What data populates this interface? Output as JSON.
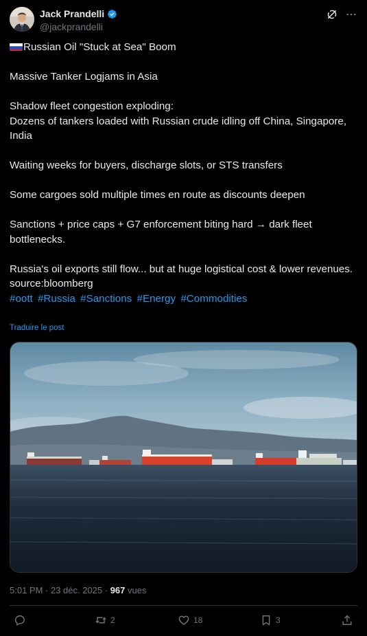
{
  "author": {
    "display_name": "Jack Prandelli",
    "handle": "@jackprandelli",
    "verified": true
  },
  "icons": {
    "verified": "verified-badge-icon",
    "grok": "grok-icon",
    "more": "more-dots-icon",
    "reply": "reply-icon",
    "repost": "repost-icon",
    "like": "heart-icon",
    "bookmark": "bookmark-icon",
    "share": "share-icon"
  },
  "tweet": {
    "line1": "Russian Oil \"Stuck at Sea\" Boom",
    "line2": "Massive Tanker Logjams in Asia",
    "line3a": "Shadow fleet congestion exploding:",
    "line3b": "Dozens of tankers loaded with Russian crude idling off China, Singapore, India",
    "line4": "Waiting weeks for buyers, discharge slots, or STS transfers",
    "line5": "Some cargoes sold multiple times en route as discounts deepen",
    "line6": "Sanctions + price caps + G7 enforcement biting hard → dark fleet bottlenecks.",
    "line7": "Russia's oil exports still flow... but at huge logistical cost & lower revenues.",
    "line8": "source:bloomberg",
    "hashtags": [
      "#oott",
      "#Russia",
      "#Sanctions",
      "#Energy",
      "#Commodities"
    ],
    "translate_label": "Traduire le post"
  },
  "meta": {
    "time": "5:01 PM · 23 déc. 2025 · ",
    "views_count": "967",
    "views_label": " vues"
  },
  "stats": {
    "reposts": "2",
    "likes": "18",
    "bookmarks": "3"
  },
  "colors": {
    "background": "#000000",
    "text": "#e7e9ea",
    "muted": "#71767b",
    "link": "#1d9bf0",
    "verified": "#1d9bf0"
  }
}
